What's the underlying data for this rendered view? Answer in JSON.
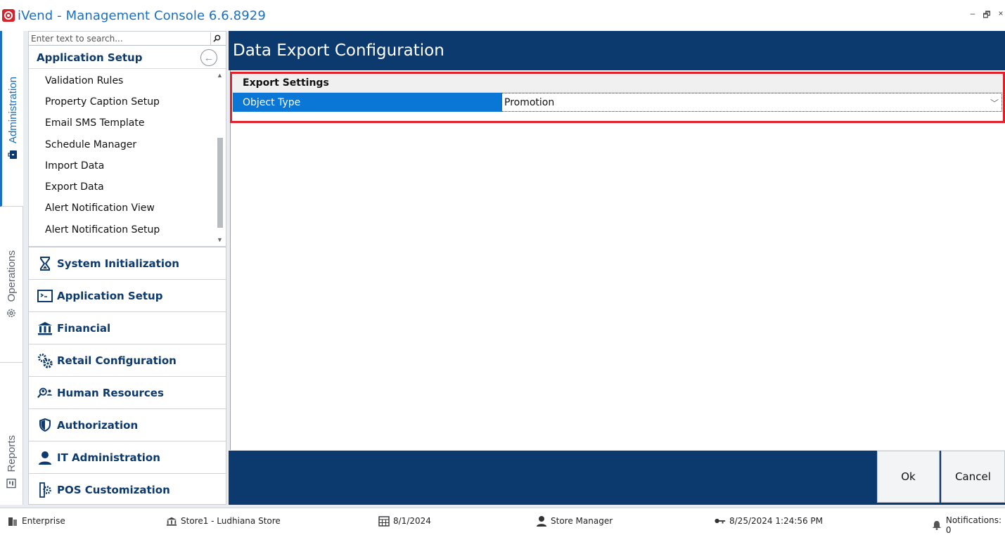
{
  "window": {
    "title": "iVend - Management Console  6.6.8929",
    "controls": [
      "–",
      "🗗",
      "×"
    ]
  },
  "left_tabs": [
    {
      "label": "Administration",
      "icon": "briefcase-icon",
      "active": true
    },
    {
      "label": "Operations",
      "icon": "gear-icon",
      "active": false
    },
    {
      "label": "Reports",
      "icon": "report-icon",
      "active": false
    }
  ],
  "nav": {
    "search_placeholder": "Enter text to search...",
    "group_title": "Application Setup",
    "sub_items": [
      "Validation Rules",
      "Property Caption Setup",
      "Email SMS Template",
      "Schedule Manager",
      "Import Data",
      "Export Data",
      "Alert Notification View",
      "Alert Notification Setup"
    ],
    "groups": [
      {
        "label": "System Initialization",
        "icon": "hourglass-icon"
      },
      {
        "label": "Application Setup",
        "icon": "console-icon"
      },
      {
        "label": "Financial",
        "icon": "bank-icon"
      },
      {
        "label": "Retail Configuration",
        "icon": "gears-icon"
      },
      {
        "label": "Human Resources",
        "icon": "people-search-icon"
      },
      {
        "label": "Authorization",
        "icon": "shield-icon"
      },
      {
        "label": "IT Administration",
        "icon": "user-icon"
      },
      {
        "label": "POS Customization",
        "icon": "pos-gear-icon"
      }
    ]
  },
  "main": {
    "title": "Data Export Configuration",
    "section_title": "Export Settings",
    "property_label": "Object Type",
    "property_value": "Promotion",
    "ok_label": "Ok",
    "cancel_label": "Cancel"
  },
  "status_bar": {
    "company": "Enterprise",
    "store": "Store1 - Ludhiana Store",
    "date": "8/1/2024",
    "role": "Store Manager",
    "login_time": "8/25/2024 1:24:56 PM",
    "notifications": "Notifications: 0"
  },
  "colors": {
    "brand_dark": "#0d3a6e",
    "accent_blue": "#0a76d6",
    "highlight_red": "#e0202b",
    "title_blue": "#1b6fc2"
  }
}
